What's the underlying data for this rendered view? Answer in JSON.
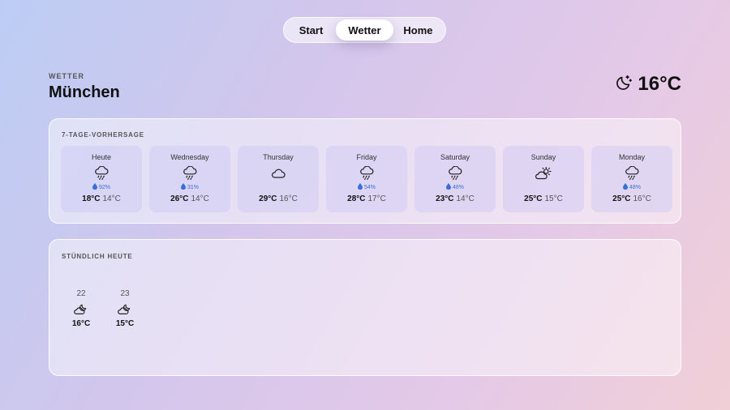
{
  "nav": {
    "items": [
      "Start",
      "Wetter",
      "Home"
    ],
    "active": "Wetter"
  },
  "header": {
    "section_label": "WETTER",
    "city": "München",
    "current_temp": "16°C",
    "current_icon": "moon-stars-icon"
  },
  "forecast": {
    "title": "7-TAGE-VORHERSAGE",
    "days": [
      {
        "name": "Heute",
        "icon": "cloud-rain-icon",
        "rain": "92%",
        "high": "18°C",
        "low": "14°C"
      },
      {
        "name": "Wednesday",
        "icon": "cloud-rain-icon",
        "rain": "31%",
        "high": "26°C",
        "low": "14°C"
      },
      {
        "name": "Thursday",
        "icon": "cloud-icon",
        "rain": "",
        "high": "29°C",
        "low": "16°C"
      },
      {
        "name": "Friday",
        "icon": "cloud-rain-icon",
        "rain": "54%",
        "high": "28°C",
        "low": "17°C"
      },
      {
        "name": "Saturday",
        "icon": "cloud-rain-icon",
        "rain": "48%",
        "high": "23°C",
        "low": "14°C"
      },
      {
        "name": "Sunday",
        "icon": "cloud-sun-icon",
        "rain": "",
        "high": "25°C",
        "low": "15°C"
      },
      {
        "name": "Monday",
        "icon": "cloud-rain-icon",
        "rain": "48%",
        "high": "25°C",
        "low": "16°C"
      }
    ]
  },
  "hourly": {
    "title": "STÜNDLICH HEUTE",
    "hours": [
      {
        "hour": "22",
        "icon": "cloud-moon-icon",
        "temp": "16°C"
      },
      {
        "hour": "23",
        "icon": "cloud-moon-icon",
        "temp": "15°C"
      }
    ]
  }
}
